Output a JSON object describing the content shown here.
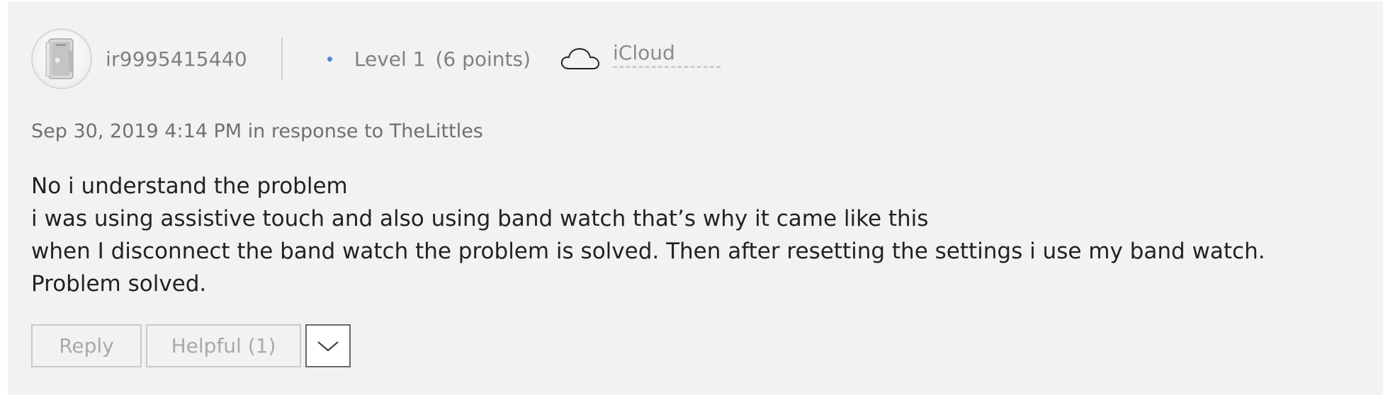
{
  "author": {
    "username": "ir9995415440",
    "level": "Level 1",
    "points": "(6 points)",
    "community_icon": "cloud-icon",
    "community": "iCloud",
    "avatar_icon": "power-mac-g4-avatar"
  },
  "post": {
    "meta": "Sep 30, 2019 4:14 PM in response to TheLittles",
    "lines": [
      "No i understand the problem",
      "i was using assistive touch and also using band watch that’s why it came like this",
      "when I disconnect the band watch the problem is solved. Then after resetting the settings i use my band watch. Problem solved."
    ]
  },
  "actions": {
    "reply_label": "Reply",
    "helpful_label": "Helpful (1)",
    "more_icon": "chevron-down-icon"
  },
  "colors": {
    "background": "#f2f2f2",
    "level_dot": "#4f86d9",
    "text_primary": "#222222",
    "text_secondary": "#808080"
  }
}
